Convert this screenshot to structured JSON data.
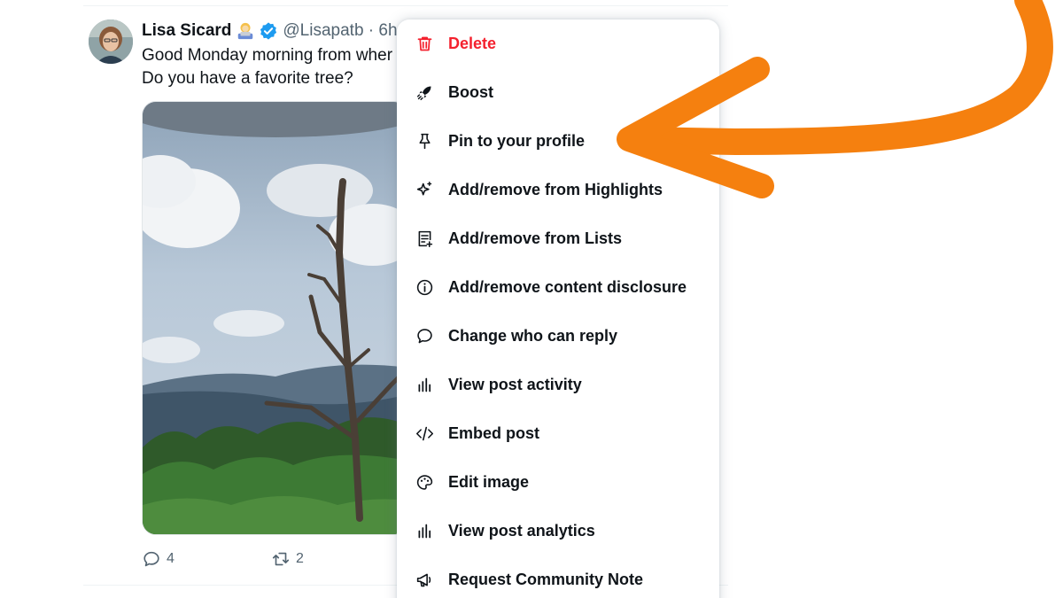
{
  "tweet": {
    "author_name": "Lisa Sicard",
    "handle_time": "@Lisapatb · 6h",
    "text_line1": "Good Monday morning from wher",
    "text_line2": "Do you have a favorite tree?",
    "reply_count": "4",
    "repost_count": "2"
  },
  "menu": {
    "items": [
      {
        "label": "Delete",
        "icon": "trash-icon"
      },
      {
        "label": "Boost",
        "icon": "rocket-icon"
      },
      {
        "label": "Pin to your profile",
        "icon": "pin-icon"
      },
      {
        "label": "Add/remove from Highlights",
        "icon": "sparkle-icon"
      },
      {
        "label": "Add/remove from Lists",
        "icon": "list-add-icon"
      },
      {
        "label": "Add/remove content disclosure",
        "icon": "info-circle-icon"
      },
      {
        "label": "Change who can reply",
        "icon": "speech-bubble-icon"
      },
      {
        "label": "View post activity",
        "icon": "bar-chart-icon"
      },
      {
        "label": "Embed post",
        "icon": "code-icon"
      },
      {
        "label": "Edit image",
        "icon": "image-edit-icon"
      },
      {
        "label": "View post analytics",
        "icon": "bar-chart-icon"
      },
      {
        "label": "Request Community Note",
        "icon": "megaphone-icon"
      }
    ]
  },
  "colors": {
    "danger": "#f4212e",
    "text": "#0f1419",
    "muted": "#536471",
    "verified": "#1d9bf0",
    "annotation_arrow": "#f5800f"
  }
}
